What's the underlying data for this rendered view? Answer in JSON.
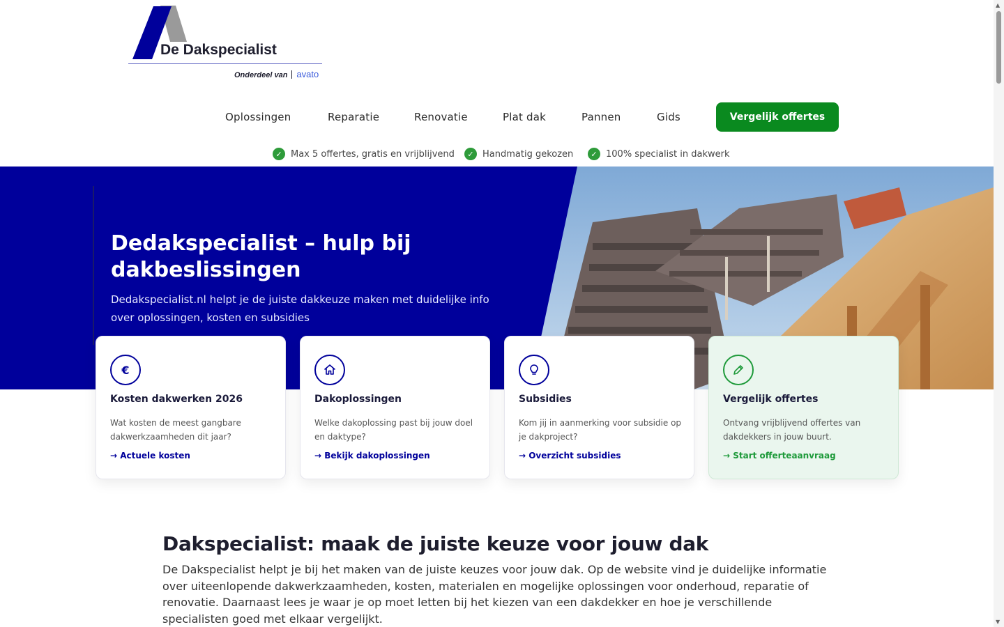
{
  "header": {
    "logo": {
      "brand": "De Dakspecialist",
      "sub_prefix": "Onderdeel van",
      "sub_brand": "avato"
    },
    "nav": [
      {
        "label": "Oplossingen"
      },
      {
        "label": "Reparatie"
      },
      {
        "label": "Renovatie"
      },
      {
        "label": "Plat dak"
      },
      {
        "label": "Pannen"
      },
      {
        "label": "Gids"
      }
    ],
    "cta_label": "Vergelijk offertes",
    "usps": [
      {
        "label": "Max 5 offertes, gratis en vrijblijvend"
      },
      {
        "label": "Handmatig gekozen"
      },
      {
        "label": "100% specialist in dakwerk"
      }
    ]
  },
  "hero": {
    "title": "Dedakspecialist – hulp bij dakbeslissingen",
    "description": "Dedakspecialist.nl helpt je de juiste dakkeuze maken met duidelijke info over oplossingen, kosten en subsidies"
  },
  "cards": [
    {
      "icon": "euro-icon",
      "glyph": "€",
      "title": "Kosten dakwerken 2026",
      "description": "Wat kosten de meest gangbare dakwerkzaamheden dit jaar?",
      "link": "→ Actuele kosten"
    },
    {
      "icon": "house-icon",
      "glyph": "",
      "title": "Dakoplossingen",
      "description": "Welke dakoplossing past bij jouw doel en daktype?",
      "link": "→ Bekijk dakoplossingen"
    },
    {
      "icon": "lightbulb-icon",
      "glyph": "",
      "title": "Subsidies",
      "description": "Kom jij in aanmerking voor subsidie op je dakproject?",
      "link": "→ Overzicht subsidies"
    },
    {
      "icon": "pencil-icon",
      "glyph": "",
      "title": "Vergelijk offertes",
      "description": "Ontvang vrijblijvend offertes van dakdekkers in jouw buurt.",
      "link": "→ Start offerteaanvraag"
    }
  ],
  "content": {
    "title": "Dakspecialist: maak de juiste keuze voor jouw dak",
    "body": "De Dakspecialist helpt je bij het maken van de juiste keuzes voor jouw dak. Op de website vind je duidelijke informatie over uiteenlopende dakwerkzaamheden, kosten, materialen en mogelijke oplossingen voor onderhoud, reparatie of renovatie. Daarnaast lees je waar je op moet letten bij het kiezen van een dakdekker en hoe je verschillende specialisten goed met elkaar vergelijkt."
  },
  "colors": {
    "brand_blue": "#00009b",
    "cta_green": "#0a8a1f",
    "check_green": "#2e9b3a"
  }
}
